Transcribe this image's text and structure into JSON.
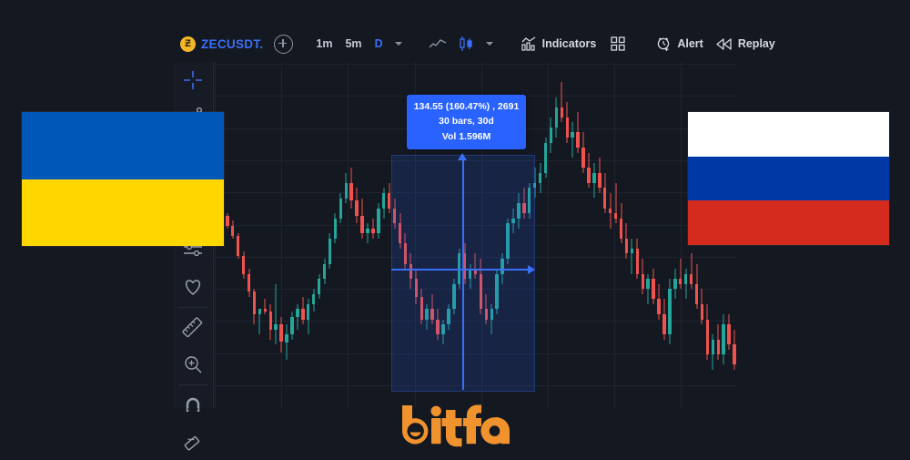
{
  "app": {
    "background_color": "#141821",
    "panel_color": "#171b26"
  },
  "toolbar": {
    "coin_icon": "zcash-coin-icon",
    "coin_symbol_glyph": "Ƶ",
    "symbol": "ZECUSDT.",
    "add_symbol_label": "add-symbol",
    "timeframes": [
      {
        "label": "1m",
        "active": false
      },
      {
        "label": "5m",
        "active": false
      },
      {
        "label": "D",
        "active": true
      }
    ],
    "timeframe_dropdown": "chevron-down-icon",
    "chart_type_line": "line-chart-icon",
    "chart_type_candles": "candlestick-icon",
    "chart_type_dropdown": "chevron-down-icon",
    "indicators_label": "Indicators",
    "indicators_icon": "indicators-icon",
    "layout_icon": "grid-layout-icon",
    "alert_label": "Alert",
    "alert_icon": "alarm-clock-plus-icon",
    "replay_label": "Replay",
    "replay_icon": "rewind-icon"
  },
  "sidebar": {
    "tools": [
      {
        "name": "crosshair-tool",
        "icon": "crosshair-icon",
        "active": true
      },
      {
        "name": "trend-line-tool",
        "icon": "trend-line-icon",
        "active": false
      },
      {
        "name": "measure-settings-tool",
        "icon": "sliders-icon",
        "active": false
      },
      {
        "name": "favorites-tool",
        "icon": "heart-icon",
        "active": false
      },
      {
        "name": "measure-tool",
        "icon": "ruler-icon",
        "active": false
      },
      {
        "name": "zoom-tool",
        "icon": "magnifier-plus-icon",
        "active": false
      },
      {
        "name": "magnet-tool",
        "icon": "magnet-icon",
        "active": false
      },
      {
        "name": "eraser-tool",
        "icon": "eraser-icon",
        "active": false
      }
    ]
  },
  "measurement": {
    "line1": "134.55 (160.47%) , 2691",
    "line2": "30 bars, 30d",
    "line3": "Vol 1.596M",
    "accent_color": "#2962ff"
  },
  "flags": {
    "left": {
      "name": "ukraine-flag",
      "bands": [
        {
          "color": "#0057b7",
          "height_pct": 50
        },
        {
          "color": "#ffd700",
          "height_pct": 50
        }
      ]
    },
    "right": {
      "name": "russia-flag",
      "bands": [
        {
          "color": "#ffffff",
          "height_pct": 33.34
        },
        {
          "color": "#0039a6",
          "height_pct": 33.33
        },
        {
          "color": "#d52b1e",
          "height_pct": 33.33
        }
      ]
    }
  },
  "logo": {
    "text": "bitfa",
    "color": "#f0922e"
  },
  "chart_data": {
    "type": "candlestick",
    "title": "ZECUSDT. Daily",
    "up_color": "#26a69a",
    "down_color": "#ef5350",
    "grid": true,
    "xlabel": "",
    "ylabel": "",
    "candles": [
      {
        "o": 96,
        "h": 99,
        "l": 92,
        "c": 93
      },
      {
        "o": 93,
        "h": 94,
        "l": 86,
        "c": 87
      },
      {
        "o": 87,
        "h": 88,
        "l": 82,
        "c": 83
      },
      {
        "o": 83,
        "h": 85,
        "l": 78,
        "c": 79
      },
      {
        "o": 79,
        "h": 80,
        "l": 70,
        "c": 71
      },
      {
        "o": 71,
        "h": 73,
        "l": 62,
        "c": 64
      },
      {
        "o": 64,
        "h": 66,
        "l": 55,
        "c": 57
      },
      {
        "o": 57,
        "h": 58,
        "l": 44,
        "c": 48
      },
      {
        "o": 48,
        "h": 50,
        "l": 40,
        "c": 50
      },
      {
        "o": 50,
        "h": 54,
        "l": 48,
        "c": 49
      },
      {
        "o": 49,
        "h": 52,
        "l": 38,
        "c": 42
      },
      {
        "o": 42,
        "h": 60,
        "l": 36,
        "c": 44
      },
      {
        "o": 44,
        "h": 47,
        "l": 33,
        "c": 37
      },
      {
        "o": 37,
        "h": 44,
        "l": 30,
        "c": 40
      },
      {
        "o": 40,
        "h": 49,
        "l": 38,
        "c": 47
      },
      {
        "o": 47,
        "h": 52,
        "l": 42,
        "c": 50
      },
      {
        "o": 50,
        "h": 55,
        "l": 44,
        "c": 46
      },
      {
        "o": 46,
        "h": 54,
        "l": 40,
        "c": 52
      },
      {
        "o": 52,
        "h": 58,
        "l": 49,
        "c": 56
      },
      {
        "o": 56,
        "h": 64,
        "l": 54,
        "c": 62
      },
      {
        "o": 62,
        "h": 70,
        "l": 60,
        "c": 68
      },
      {
        "o": 68,
        "h": 80,
        "l": 66,
        "c": 78
      },
      {
        "o": 78,
        "h": 88,
        "l": 76,
        "c": 86
      },
      {
        "o": 86,
        "h": 96,
        "l": 84,
        "c": 94
      },
      {
        "o": 94,
        "h": 104,
        "l": 92,
        "c": 100
      },
      {
        "o": 100,
        "h": 106,
        "l": 90,
        "c": 93
      },
      {
        "o": 93,
        "h": 98,
        "l": 84,
        "c": 87
      },
      {
        "o": 87,
        "h": 94,
        "l": 78,
        "c": 80
      },
      {
        "o": 80,
        "h": 84,
        "l": 76,
        "c": 82
      },
      {
        "o": 82,
        "h": 86,
        "l": 78,
        "c": 80
      },
      {
        "o": 80,
        "h": 92,
        "l": 78,
        "c": 90
      },
      {
        "o": 90,
        "h": 98,
        "l": 86,
        "c": 96
      },
      {
        "o": 96,
        "h": 100,
        "l": 88,
        "c": 90
      },
      {
        "o": 90,
        "h": 94,
        "l": 82,
        "c": 84
      },
      {
        "o": 84,
        "h": 88,
        "l": 74,
        "c": 76
      },
      {
        "o": 76,
        "h": 80,
        "l": 66,
        "c": 68
      },
      {
        "o": 68,
        "h": 72,
        "l": 58,
        "c": 62
      },
      {
        "o": 62,
        "h": 66,
        "l": 52,
        "c": 55
      },
      {
        "o": 55,
        "h": 58,
        "l": 44,
        "c": 46
      },
      {
        "o": 46,
        "h": 52,
        "l": 42,
        "c": 50
      },
      {
        "o": 50,
        "h": 56,
        "l": 44,
        "c": 46
      },
      {
        "o": 46,
        "h": 50,
        "l": 38,
        "c": 40
      },
      {
        "o": 40,
        "h": 46,
        "l": 36,
        "c": 44
      },
      {
        "o": 44,
        "h": 52,
        "l": 42,
        "c": 50
      },
      {
        "o": 50,
        "h": 62,
        "l": 48,
        "c": 60
      },
      {
        "o": 60,
        "h": 74,
        "l": 58,
        "c": 72
      },
      {
        "o": 72,
        "h": 76,
        "l": 60,
        "c": 62
      },
      {
        "o": 62,
        "h": 68,
        "l": 58,
        "c": 66
      },
      {
        "o": 66,
        "h": 72,
        "l": 62,
        "c": 64
      },
      {
        "o": 64,
        "h": 70,
        "l": 48,
        "c": 50
      },
      {
        "o": 50,
        "h": 56,
        "l": 44,
        "c": 46
      },
      {
        "o": 46,
        "h": 52,
        "l": 40,
        "c": 50
      },
      {
        "o": 50,
        "h": 66,
        "l": 48,
        "c": 64
      },
      {
        "o": 64,
        "h": 72,
        "l": 60,
        "c": 70
      },
      {
        "o": 70,
        "h": 86,
        "l": 68,
        "c": 84
      },
      {
        "o": 84,
        "h": 90,
        "l": 80,
        "c": 86
      },
      {
        "o": 86,
        "h": 96,
        "l": 82,
        "c": 92
      },
      {
        "o": 92,
        "h": 98,
        "l": 86,
        "c": 88
      },
      {
        "o": 88,
        "h": 100,
        "l": 86,
        "c": 98
      },
      {
        "o": 98,
        "h": 106,
        "l": 94,
        "c": 100
      },
      {
        "o": 100,
        "h": 108,
        "l": 96,
        "c": 104
      },
      {
        "o": 104,
        "h": 118,
        "l": 102,
        "c": 116
      },
      {
        "o": 116,
        "h": 126,
        "l": 112,
        "c": 122
      },
      {
        "o": 122,
        "h": 134,
        "l": 118,
        "c": 130
      },
      {
        "o": 130,
        "h": 140,
        "l": 124,
        "c": 126
      },
      {
        "o": 126,
        "h": 132,
        "l": 116,
        "c": 118
      },
      {
        "o": 118,
        "h": 124,
        "l": 110,
        "c": 120
      },
      {
        "o": 120,
        "h": 128,
        "l": 112,
        "c": 114
      },
      {
        "o": 114,
        "h": 120,
        "l": 104,
        "c": 106
      },
      {
        "o": 106,
        "h": 112,
        "l": 98,
        "c": 100
      },
      {
        "o": 100,
        "h": 108,
        "l": 94,
        "c": 104
      },
      {
        "o": 104,
        "h": 110,
        "l": 96,
        "c": 98
      },
      {
        "o": 98,
        "h": 104,
        "l": 88,
        "c": 90
      },
      {
        "o": 90,
        "h": 96,
        "l": 82,
        "c": 88
      },
      {
        "o": 88,
        "h": 100,
        "l": 84,
        "c": 86
      },
      {
        "o": 86,
        "h": 92,
        "l": 76,
        "c": 78
      },
      {
        "o": 78,
        "h": 84,
        "l": 70,
        "c": 72
      },
      {
        "o": 72,
        "h": 78,
        "l": 64,
        "c": 74
      },
      {
        "o": 74,
        "h": 78,
        "l": 62,
        "c": 64
      },
      {
        "o": 64,
        "h": 70,
        "l": 56,
        "c": 58
      },
      {
        "o": 58,
        "h": 64,
        "l": 52,
        "c": 62
      },
      {
        "o": 62,
        "h": 66,
        "l": 52,
        "c": 54
      },
      {
        "o": 54,
        "h": 60,
        "l": 46,
        "c": 48
      },
      {
        "o": 48,
        "h": 54,
        "l": 38,
        "c": 40
      },
      {
        "o": 40,
        "h": 62,
        "l": 36,
        "c": 58
      },
      {
        "o": 58,
        "h": 66,
        "l": 54,
        "c": 62
      },
      {
        "o": 62,
        "h": 70,
        "l": 58,
        "c": 60
      },
      {
        "o": 60,
        "h": 66,
        "l": 54,
        "c": 64
      },
      {
        "o": 64,
        "h": 72,
        "l": 58,
        "c": 60
      },
      {
        "o": 60,
        "h": 68,
        "l": 50,
        "c": 52
      },
      {
        "o": 52,
        "h": 58,
        "l": 44,
        "c": 46
      },
      {
        "o": 46,
        "h": 52,
        "l": 30,
        "c": 32
      },
      {
        "o": 32,
        "h": 40,
        "l": 26,
        "c": 38
      },
      {
        "o": 38,
        "h": 44,
        "l": 30,
        "c": 32
      },
      {
        "o": 32,
        "h": 48,
        "l": 28,
        "c": 44
      },
      {
        "o": 44,
        "h": 48,
        "l": 34,
        "c": 36
      },
      {
        "o": 36,
        "h": 42,
        "l": 26,
        "c": 28
      }
    ]
  }
}
